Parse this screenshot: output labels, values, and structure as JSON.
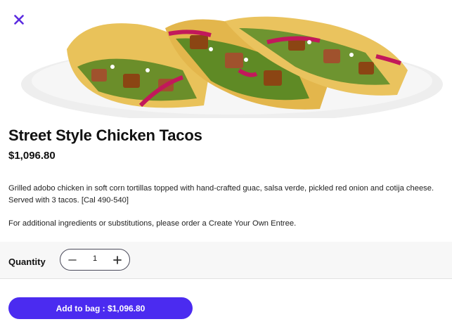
{
  "colors": {
    "accent": "#4b2bf0",
    "close_icon": "#5b2be0",
    "band": "#f7f7f7"
  },
  "header": {
    "close_icon": "close-icon",
    "image": "street-style-chicken-tacos-photo"
  },
  "item": {
    "title": "Street Style Chicken Tacos",
    "price": "$1,096.80",
    "description": "Grilled adobo chicken in soft corn tortillas topped with hand-crafted guac, salsa verde, pickled red onion and cotija cheese. Served with 3 tacos. [Cal 490-540]",
    "note": "For additional ingredients or substitutions, please order a Create Your Own Entree."
  },
  "quantity": {
    "label": "Quantity",
    "value": "1",
    "minus_icon": "minus-icon",
    "plus_icon": "plus-icon"
  },
  "cta": {
    "label": "Add to bag : $1,096.80"
  }
}
